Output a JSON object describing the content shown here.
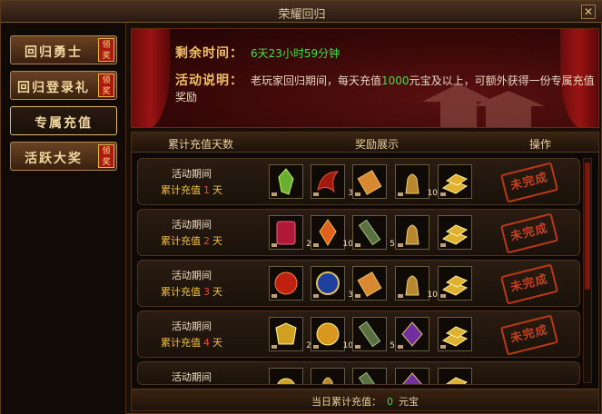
{
  "window": {
    "title": "荣耀回归"
  },
  "sidebar": {
    "items": [
      {
        "label": "回归勇士",
        "badge": "领奖",
        "active": false
      },
      {
        "label": "回归登录礼",
        "badge": "领奖",
        "active": false
      },
      {
        "label": "专属充值",
        "badge": "",
        "active": true
      },
      {
        "label": "活跃大奖",
        "badge": "领奖",
        "active": false
      }
    ]
  },
  "banner": {
    "time_key": "剩余时间：",
    "time_value": "6天23小时59分钟",
    "desc_key": "活动说明：",
    "desc_pre": "老玩家回归期间，每天充值",
    "desc_amount": "1000",
    "desc_post": "元宝及以上，可额外获得一份专属充值奖励"
  },
  "table": {
    "headers": {
      "days": "累计充值天数",
      "rewards": "奖励展示",
      "action": "操作"
    },
    "rows": [
      {
        "line1": "活动期间",
        "pre": "累计充值",
        "days": "1",
        "unit": "天",
        "status": "未完成",
        "items": [
          {
            "icon": "green-crystal-icon",
            "count": ""
          },
          {
            "icon": "red-claw-icon",
            "count": "3"
          },
          {
            "icon": "scroll-icon",
            "count": ""
          },
          {
            "icon": "gold-statue-icon",
            "count": "10"
          },
          {
            "icon": "gold-bars-icon",
            "count": ""
          }
        ]
      },
      {
        "line1": "活动期间",
        "pre": "累计充值",
        "days": "2",
        "unit": "天",
        "status": "未完成",
        "items": [
          {
            "icon": "red-cloth-icon",
            "count": "2"
          },
          {
            "icon": "fire-crystal-icon",
            "count": "10"
          },
          {
            "icon": "green-scroll-icon",
            "count": "5"
          },
          {
            "icon": "gold-statue-icon",
            "count": ""
          },
          {
            "icon": "gold-bars-icon",
            "count": ""
          }
        ]
      },
      {
        "line1": "活动期间",
        "pre": "累计充值",
        "days": "3",
        "unit": "天",
        "status": "未完成",
        "items": [
          {
            "icon": "red-orb-icon",
            "count": ""
          },
          {
            "icon": "blue-emblem-icon",
            "count": "3"
          },
          {
            "icon": "scroll-icon",
            "count": ""
          },
          {
            "icon": "gold-statue-icon",
            "count": "10"
          },
          {
            "icon": "gold-bars-icon",
            "count": ""
          }
        ]
      },
      {
        "line1": "活动期间",
        "pre": "累计充值",
        "days": "4",
        "unit": "天",
        "status": "未完成",
        "items": [
          {
            "icon": "gold-armor-icon",
            "count": "2"
          },
          {
            "icon": "gold-medal-icon",
            "count": "10"
          },
          {
            "icon": "green-scroll-icon",
            "count": "5"
          },
          {
            "icon": "purple-gem-icon",
            "count": ""
          },
          {
            "icon": "gold-bars-icon",
            "count": ""
          }
        ]
      },
      {
        "line1": "活动期间",
        "pre": "",
        "days": "",
        "unit": "",
        "status": "",
        "items": [
          {
            "icon": "gold-orb-icon",
            "count": ""
          },
          {
            "icon": "gold-statue-icon",
            "count": ""
          },
          {
            "icon": "green-scroll-icon",
            "count": ""
          },
          {
            "icon": "purple-gem-icon",
            "count": ""
          },
          {
            "icon": "gold-bars-icon",
            "count": ""
          }
        ]
      }
    ]
  },
  "footer": {
    "pre": "当日累计充值：",
    "value": "0",
    "unit": "元宝"
  },
  "colors": {
    "accent_green": "#40e040",
    "accent_red": "#ff4030",
    "gold": "#f0c040",
    "stamp": "#c84020"
  }
}
